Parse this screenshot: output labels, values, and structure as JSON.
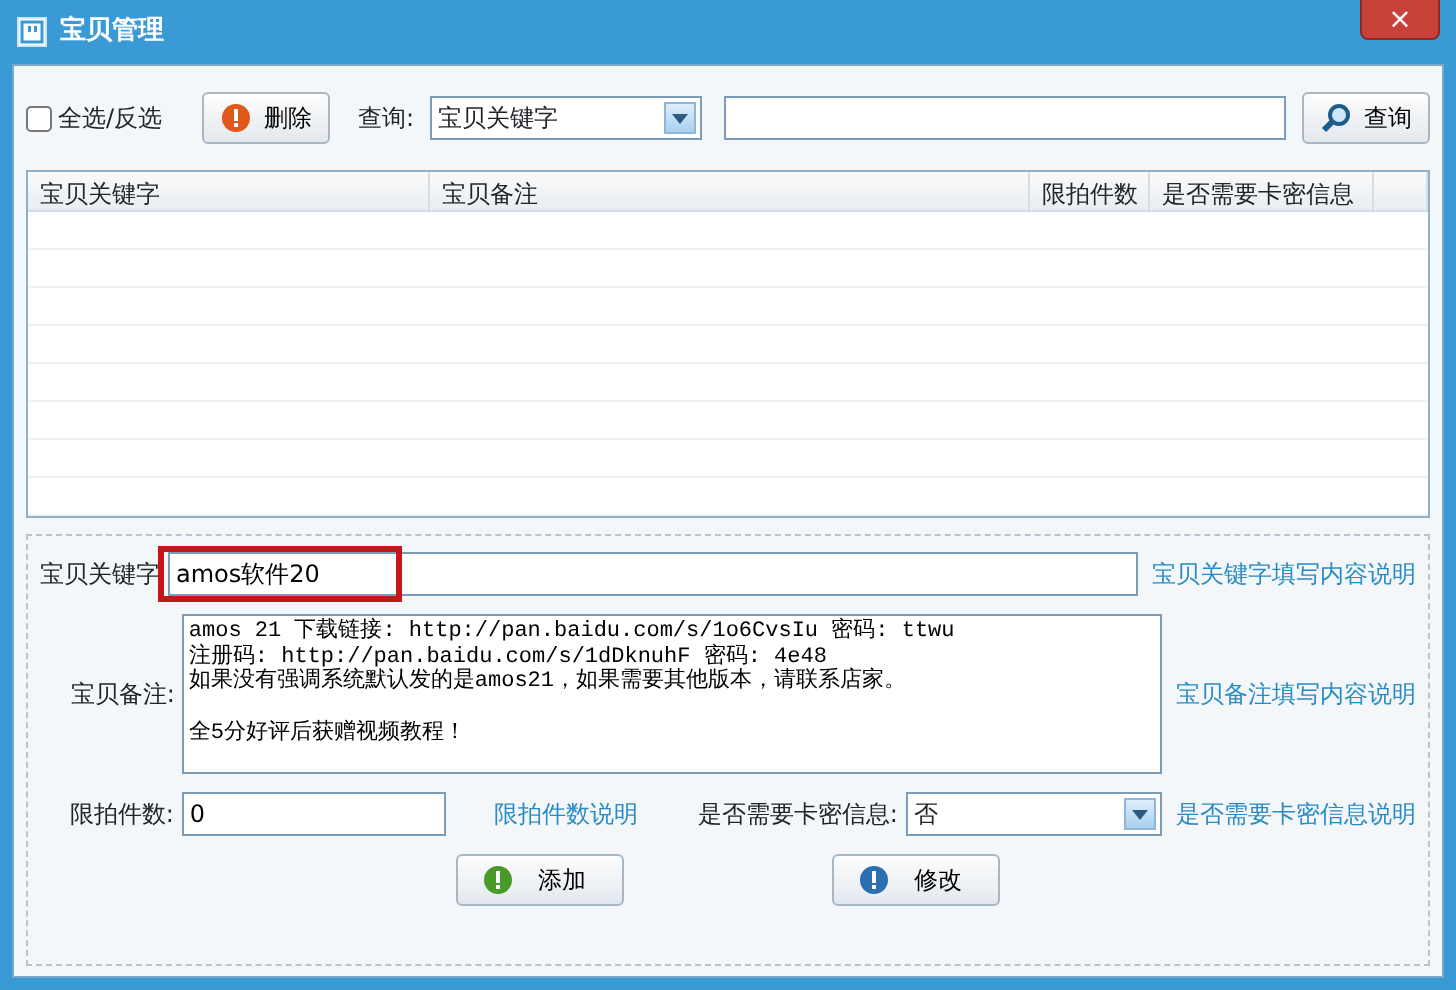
{
  "window": {
    "title": "宝贝管理",
    "close": "×"
  },
  "toolbar": {
    "select_all": {
      "label": "全选/反选",
      "checked": false
    },
    "delete_button": "删除",
    "query_label": "查询:",
    "query_field": {
      "value": "宝贝关键字"
    },
    "search_button": "查询"
  },
  "table": {
    "columns": [
      "宝贝关键字",
      "宝贝备注",
      "限拍件数",
      "是否需要卡密信息"
    ]
  },
  "form": {
    "keyword_label": "宝贝关键字",
    "keyword_value": "amos软件20",
    "keyword_help": "宝贝关键字填写内容说明",
    "note_label": "宝贝备注:",
    "note_paragraphs": [
      [
        "amos 21 下载链接: http://pan.baidu.com/s/1o6CvsIu 密码: ttwu",
        "注册码: http://pan.baidu.com/s/1dDknuhF 密码: 4e48",
        "如果没有强调系统默认发的是amos21，如果需要其他版本，请联系店家。"
      ],
      [
        "全5分好评后获赠视频教程！"
      ]
    ],
    "note_help": "宝贝备注填写内容说明",
    "limit_label": "限拍件数:",
    "limit_value": "0",
    "limit_help": "限拍件数说明",
    "card_label": "是否需要卡密信息:",
    "card_value": "否",
    "card_help": "是否需要卡密信息说明",
    "add_button": "添加",
    "edit_button": "修改"
  }
}
